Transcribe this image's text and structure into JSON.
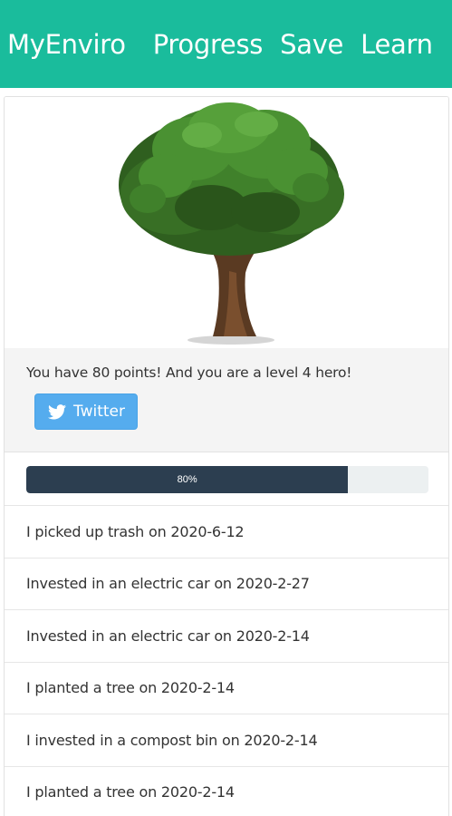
{
  "nav": {
    "brand": "MyEnviro",
    "links": [
      "Progress",
      "Save",
      "Learn"
    ]
  },
  "tree_image": {
    "name": "tree-illustration"
  },
  "status": {
    "message": "You have 80 points! And you are a level 4 hero!",
    "twitter_label": "Twitter"
  },
  "progress": {
    "percent": 80,
    "label": "80%"
  },
  "activities": [
    "I picked up trash on 2020-6-12",
    "Invested in an electric car on 2020-2-27",
    "Invested in an electric car on 2020-2-14",
    "I planted a tree on 2020-2-14",
    "I invested in a compost bin on 2020-2-14",
    "I planted a tree on 2020-2-14"
  ],
  "colors": {
    "navbar": "#1abc9c",
    "twitter": "#55acee",
    "progress_fill": "#2c3e50",
    "progress_track": "#ecf0f1"
  }
}
